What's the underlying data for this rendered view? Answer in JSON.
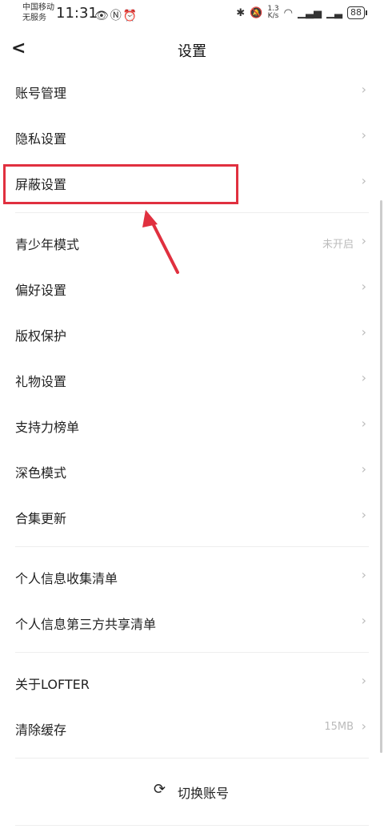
{
  "status_bar": {
    "carrier_line1": "中国移动",
    "carrier_line2": "无服务",
    "time": "11:31",
    "speed_top": "1.3",
    "speed_bottom": "K/s",
    "battery": "88"
  },
  "nav": {
    "title": "设置",
    "back_icon": "back-chevron-icon"
  },
  "items": [
    {
      "label": "账号管理"
    },
    {
      "label": "隐私设置"
    },
    {
      "label": "屏蔽设置"
    },
    {
      "label": "青少年模式",
      "value": "未开启"
    },
    {
      "label": "偏好设置"
    },
    {
      "label": "版权保护"
    },
    {
      "label": "礼物设置"
    },
    {
      "label": "支持力榜单"
    },
    {
      "label": "深色模式"
    },
    {
      "label": "合集更新"
    },
    {
      "label": "个人信息收集清单"
    },
    {
      "label": "个人信息第三方共享清单"
    },
    {
      "label": "关于LOFTER"
    },
    {
      "label": "清除缓存",
      "value": "15MB"
    }
  ],
  "footer": {
    "switch_label": "切换账号",
    "switch_icon": "refresh-icon"
  },
  "colors": {
    "highlight": "#e0303f",
    "chevron": "#bbbbbb",
    "divider": "#eeeeee"
  }
}
